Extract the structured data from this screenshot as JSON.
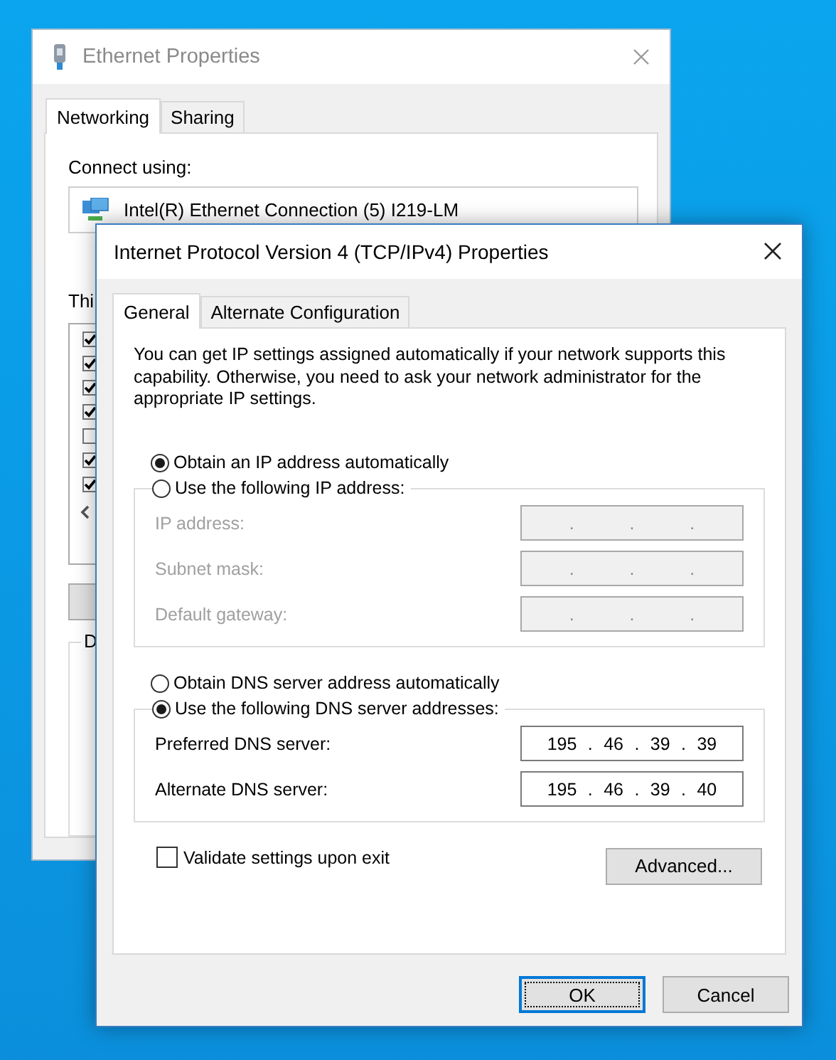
{
  "back_window": {
    "title": "Ethernet Properties",
    "tabs": [
      {
        "label": "Networking",
        "selected": true
      },
      {
        "label": "Sharing",
        "selected": false
      }
    ],
    "connect_label": "Connect using:",
    "adapter": "Intel(R) Ethernet Connection (5) I219-LM",
    "list_label": "Thi",
    "components": [
      {
        "checked": true
      },
      {
        "checked": true
      },
      {
        "checked": true
      },
      {
        "checked": true
      },
      {
        "checked": false
      },
      {
        "checked": true
      },
      {
        "checked": true
      }
    ],
    "group_label": "D"
  },
  "dialog": {
    "title": "Internet Protocol Version 4 (TCP/IPv4) Properties",
    "tabs": [
      {
        "label": "General",
        "selected": true
      },
      {
        "label": "Alternate Configuration",
        "selected": false
      }
    ],
    "description": "You can get IP settings assigned automatically if your network supports this capability. Otherwise, you need to ask your network administrator for the appropriate IP settings.",
    "ip_auto": {
      "label": "Obtain an IP address automatically",
      "selected": true
    },
    "ip_manual": {
      "label": "Use the following IP address:",
      "selected": false
    },
    "ip_fields": [
      {
        "label": "IP address:",
        "value": ". . .",
        "disabled": true
      },
      {
        "label": "Subnet mask:",
        "value": ". . .",
        "disabled": true
      },
      {
        "label": "Default gateway:",
        "value": ". . .",
        "disabled": true
      }
    ],
    "dns_auto": {
      "label": "Obtain DNS server address automatically",
      "selected": false
    },
    "dns_manual": {
      "label": "Use the following DNS server addresses:",
      "selected": true
    },
    "dns_fields": [
      {
        "label": "Preferred DNS server:",
        "value": "195 . 46 . 39 . 39",
        "disabled": false
      },
      {
        "label": "Alternate DNS server:",
        "value": "195 . 46 . 39 . 40",
        "disabled": false
      }
    ],
    "validate": {
      "label": "Validate settings upon exit",
      "checked": false
    },
    "advanced_button": "Advanced...",
    "buttons": [
      {
        "label": "OK",
        "default": true
      },
      {
        "label": "Cancel",
        "default": false
      }
    ]
  }
}
